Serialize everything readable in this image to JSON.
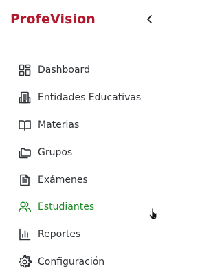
{
  "brand": {
    "name": "ProfeVision",
    "color": "#b3192d"
  },
  "sidebar": {
    "collapse_icon": "chevron-left-icon",
    "active_color": "#1e8a27",
    "items": [
      {
        "label": "Dashboard",
        "icon": "dashboard-grid-icon",
        "active": false
      },
      {
        "label": "Entidades Educativas",
        "icon": "building-icon",
        "active": false
      },
      {
        "label": "Materias",
        "icon": "book-open-icon",
        "active": false
      },
      {
        "label": "Grupos",
        "icon": "folders-icon",
        "active": false
      },
      {
        "label": "Exámenes",
        "icon": "file-text-icon",
        "active": false
      },
      {
        "label": "Estudiantes",
        "icon": "users-icon",
        "active": true
      },
      {
        "label": "Reportes",
        "icon": "bar-chart-icon",
        "active": false
      },
      {
        "label": "Configuración",
        "icon": "gear-icon",
        "active": false
      }
    ]
  }
}
